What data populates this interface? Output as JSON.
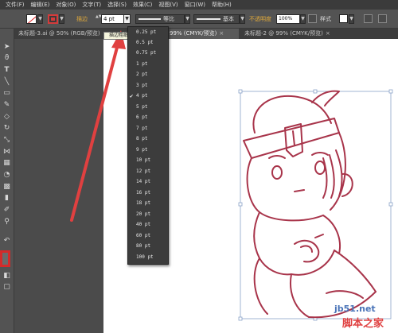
{
  "menubar": {
    "items": [
      "文件(F)",
      "编辑(E)",
      "对象(O)",
      "文字(T)",
      "选择(S)",
      "效果(C)",
      "视图(V)",
      "窗口(W)",
      "帮助(H)"
    ]
  },
  "controlbar": {
    "stroke_label": "描边",
    "stroke_weight_value": "4 pt",
    "profile_uniform": "等比",
    "brush_basic": "基本",
    "opacity_label": "不透明度",
    "opacity_value": "100%",
    "style_label": "样式",
    "dropdown_arrow": "▼",
    "spin_arrows": "▲▼"
  },
  "tabs": [
    {
      "label": "未标题-3.ai @ 50% (RGB/预览)",
      "close": "×"
    },
    {
      "label": "99% (CMYK/预览)",
      "close": "×"
    },
    {
      "label": "未标题-2 @ 99% (CMYK/预览)",
      "close": "×"
    }
  ],
  "tooltip": "描边粗细",
  "stroke_weight_options": [
    {
      "label": "0.25 pt",
      "selected": false
    },
    {
      "label": "0.5 pt",
      "selected": false
    },
    {
      "label": "0.75 pt",
      "selected": false
    },
    {
      "label": "1 pt",
      "selected": false
    },
    {
      "label": "2 pt",
      "selected": false
    },
    {
      "label": "3 pt",
      "selected": false
    },
    {
      "label": "4 pt",
      "selected": true
    },
    {
      "label": "5 pt",
      "selected": false
    },
    {
      "label": "6 pt",
      "selected": false
    },
    {
      "label": "7 pt",
      "selected": false
    },
    {
      "label": "8 pt",
      "selected": false
    },
    {
      "label": "9 pt",
      "selected": false
    },
    {
      "label": "10 pt",
      "selected": false
    },
    {
      "label": "12 pt",
      "selected": false
    },
    {
      "label": "14 pt",
      "selected": false
    },
    {
      "label": "16 pt",
      "selected": false
    },
    {
      "label": "18 pt",
      "selected": false
    },
    {
      "label": "20 pt",
      "selected": false
    },
    {
      "label": "40 pt",
      "selected": false
    },
    {
      "label": "60 pt",
      "selected": false
    },
    {
      "label": "80 pt",
      "selected": false
    },
    {
      "label": "100 pt",
      "selected": false
    }
  ],
  "check_mark": "✔",
  "watermark": {
    "site": "jb51.net",
    "name": "脚本之家"
  },
  "colors": {
    "accent_stroke": "#d42a2a",
    "drawing_stroke": "#a8344a",
    "arrow": "#e04040"
  },
  "toolbar_icons": [
    "selection-icon",
    "direct-selection-icon",
    "lasso-icon",
    "type-icon",
    "line-icon",
    "rectangle-icon",
    "pencil-icon",
    "eraser-icon",
    "rotate-icon",
    "scale-icon",
    "width-icon",
    "free-transform-icon",
    "shape-builder-icon",
    "perspective-icon",
    "mesh-icon",
    "gradient-icon",
    "eyedropper-icon",
    "blend-icon",
    "symbol-icon",
    "graph-icon",
    "artboard-icon",
    "slice-icon",
    "hand-icon",
    "zoom-icon"
  ]
}
